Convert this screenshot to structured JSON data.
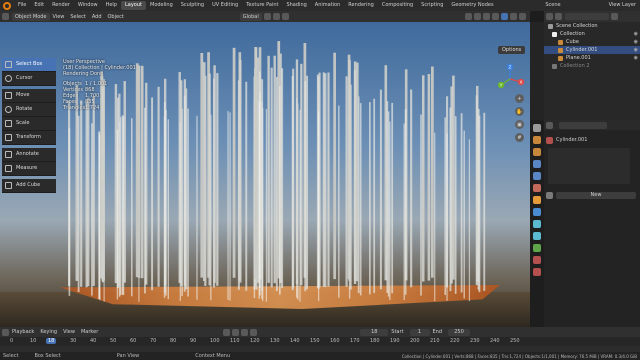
{
  "topbar": {
    "menus": [
      "File",
      "Edit",
      "Render",
      "Window",
      "Help"
    ],
    "workspaces": [
      "Layout",
      "Modeling",
      "Sculpting",
      "UV Editing",
      "Texture Paint",
      "Shading",
      "Animation",
      "Rendering",
      "Compositing",
      "Scripting",
      "Geometry Nodes"
    ],
    "active_workspace": "Layout",
    "scene": "Scene",
    "view_layer": "View Layer"
  },
  "viewport_header": {
    "mode": "Object Mode",
    "menus": [
      "View",
      "Select",
      "Add",
      "Object"
    ],
    "orientation": "Global",
    "options": "Options"
  },
  "toolbar": [
    {
      "label": "Select Box",
      "active": true
    },
    {
      "label": "Cursor",
      "active": false
    },
    {
      "label": "Move",
      "active": false
    },
    {
      "label": "Rotate",
      "active": false
    },
    {
      "label": "Scale",
      "active": false
    },
    {
      "label": "Transform",
      "active": false
    },
    {
      "label": "Annotate",
      "active": false
    },
    {
      "label": "Measure",
      "active": false
    },
    {
      "label": "Add Cube",
      "active": false
    }
  ],
  "overlay": {
    "line1": "User Perspective",
    "line2": "(18) Collection | Cylinder.001",
    "line3": "Rendering Done",
    "stats": [
      {
        "k": "Objects",
        "v": "1 / 1,001"
      },
      {
        "k": "Vertices",
        "v": "868"
      },
      {
        "k": "Edges",
        "v": "1,700"
      },
      {
        "k": "Faces",
        "v": "835"
      },
      {
        "k": "Triangles",
        "v": "1,724"
      }
    ]
  },
  "gizmo": {
    "y": "Y",
    "z": "Z",
    "x": "X"
  },
  "outliner": {
    "rows": [
      {
        "label": "Scene Collection",
        "sel": false
      },
      {
        "label": "Collection",
        "sel": false
      },
      {
        "label": "Cube",
        "sel": false
      },
      {
        "label": "Cylinder.001",
        "sel": true
      },
      {
        "label": "Plane.001",
        "sel": false
      },
      {
        "label": "Collection 2",
        "sel": false
      }
    ]
  },
  "properties": {
    "object_name": "Cylinder.001",
    "new_button": "New"
  },
  "timeline": {
    "menus": [
      "Playback",
      "Keying",
      "View",
      "Marker"
    ],
    "current_frame": "18",
    "start_label": "Start",
    "start": "1",
    "end_label": "End",
    "end": "250",
    "ticks": [
      "0",
      "10",
      "18",
      "30",
      "40",
      "50",
      "60",
      "70",
      "80",
      "90",
      "100",
      "110",
      "120",
      "130",
      "140",
      "150",
      "160",
      "170",
      "180",
      "190",
      "200",
      "210",
      "220",
      "230",
      "240",
      "250"
    ]
  },
  "statusbar": {
    "left": [
      "Select",
      "Box Select",
      "Pan View",
      "Context Menu"
    ],
    "right": "Collection | Cylinder.001 | Verts:868 | Faces:835 | Tris:1,724 | Objects:1/1,001 | Memory: 76.5 MiB | VRAM: 0.3/4.0 GiB"
  },
  "colors": {
    "accent": "#4772b3",
    "orange": "#e87d0d"
  }
}
